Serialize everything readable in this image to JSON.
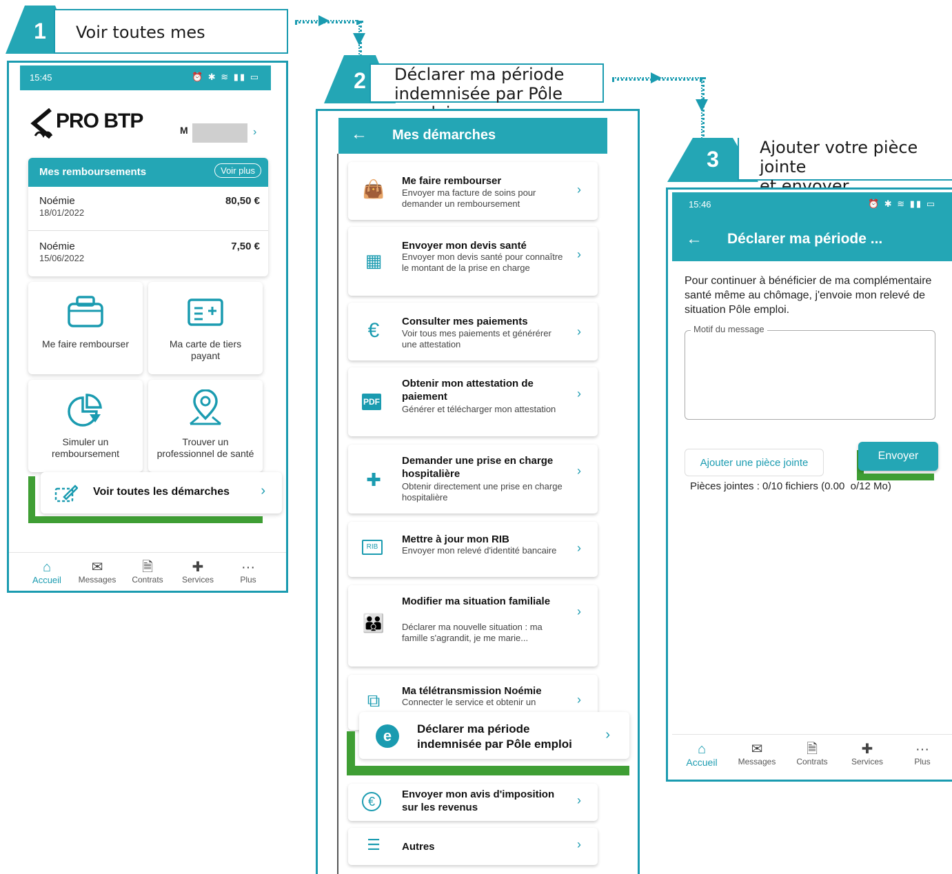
{
  "colors": {
    "accent": "#24a6b5",
    "frame": "#1a9bb0",
    "highlight": "#3f9e34"
  },
  "steps": [
    {
      "number": "1",
      "label": "Voir toutes mes démarches"
    },
    {
      "number": "2",
      "label_line1": "Déclarer ma période",
      "label_line2": "indemnisée par Pôle emploi"
    },
    {
      "number": "3",
      "label_line1": "Ajouter votre pièce jointe",
      "label_line2": "et envoyer"
    }
  ],
  "screen1": {
    "time": "15:45",
    "status_icons": "⏰ ✱ ≋ ▮▮ ▭",
    "logo": "PRO BTP",
    "user_initial": "M",
    "reimbursements": {
      "title": "Mes remboursements",
      "more_label": "Voir plus",
      "items": [
        {
          "name": "Noémie",
          "date": "18/01/2022",
          "amount": "80,50 €"
        },
        {
          "name": "Noémie",
          "date": "15/06/2022",
          "amount": "7,50 €"
        }
      ]
    },
    "tiles": [
      {
        "icon": "wallet-icon",
        "label": "Me faire rembourser"
      },
      {
        "icon": "card-icon",
        "label_line1": "Ma carte de tiers",
        "label_line2": "payant"
      },
      {
        "icon": "chart-pie-icon",
        "label_line1": "Simuler un",
        "label_line2": "remboursement"
      },
      {
        "icon": "map-pin-icon",
        "label_line1": "Trouver un",
        "label_line2": "professionnel de santé"
      }
    ],
    "all_procedures": "Voir toutes les démarches",
    "nav": [
      "Accueil",
      "Messages",
      "Contrats",
      "Services",
      "Plus"
    ]
  },
  "screen2": {
    "header": "Mes démarches",
    "items": [
      {
        "icon": "wallet-icon",
        "title": "Me faire rembourser",
        "desc": "Envoyer ma facture de soins pour demander un remboursement"
      },
      {
        "icon": "calculator-icon",
        "title": "Envoyer mon devis santé",
        "desc": "Envoyer mon devis santé pour connaître le montant de la prise en charge"
      },
      {
        "icon": "euro-icon",
        "title": "Consulter mes paiements",
        "desc": "Voir tous mes paiements et générérer une attestation"
      },
      {
        "icon": "pdf-icon",
        "title": "Obtenir mon attestation de paiement",
        "desc": "Générer et télécharger mon attestation"
      },
      {
        "icon": "hospital-cross-icon",
        "title": "Demander une prise en charge hospitalière",
        "desc": "Obtenir directement une prise en charge hospitalière"
      },
      {
        "icon": "rib-icon",
        "title": "Mettre à jour mon RIB",
        "desc": "Envoyer mon relevé d'identité bancaire"
      },
      {
        "icon": "family-icon",
        "title": "Modifier ma situation familiale",
        "desc": "Déclarer ma nouvelle situation : ma famille s'agrandit, je me marie..."
      },
      {
        "icon": "teletransmission-icon",
        "title": "Ma télétransmission Noémie",
        "desc": "Connecter le service et obtenir un"
      }
    ],
    "highlight": {
      "icon": "pole-emploi-icon",
      "title_line1": "Déclarer ma période",
      "title_line2": "indemnisée par Pôle emploi"
    },
    "after_items": [
      {
        "icon": "euro-circle-icon",
        "title": "Envoyer mon avis d'imposition sur les revenus"
      },
      {
        "icon": "list-icon",
        "title": "Autres"
      }
    ]
  },
  "screen3": {
    "time": "15:46",
    "status_icons": "⏰ ✱ ≋ ▮▮ ▭",
    "header": "Déclarer ma période ...",
    "intro": "Pour continuer à bénéficier de ma complémentaire santé même au chômage, j'envoie mon relevé de situation Pôle emploi.",
    "message_label": "Motif du message",
    "message_value": "",
    "attach_button": "Ajouter une pièce jointe",
    "send_button": "Envoyer",
    "attachments": "Pièces jointes : 0/10 fichiers (0.00  o/12 Mo)",
    "nav": [
      "Accueil",
      "Messages",
      "Contrats",
      "Services",
      "Plus"
    ]
  }
}
